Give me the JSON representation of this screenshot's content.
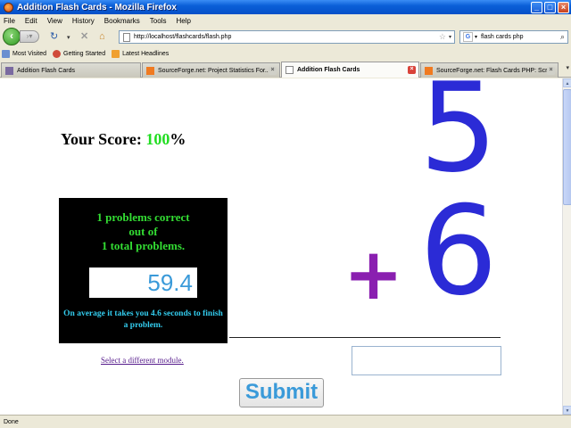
{
  "window": {
    "title": "Addition Flash Cards - Mozilla Firefox",
    "minimize_label": "_",
    "maximize_label": "□",
    "close_label": "×"
  },
  "menu": [
    "File",
    "Edit",
    "View",
    "History",
    "Bookmarks",
    "Tools",
    "Help"
  ],
  "nav": {
    "url": "http://localhost/flashcards/flash.php",
    "search_query": "flash cards php"
  },
  "bookmarks": [
    "Most Visited",
    "Getting Started",
    "Latest Headlines"
  ],
  "tabs": [
    {
      "label": "Addition Flash Cards",
      "active": false
    },
    {
      "label": "SourceForge.net: Project Statistics For...",
      "active": false
    },
    {
      "label": "Addition Flash Cards",
      "active": true
    },
    {
      "label": "SourceForge.net: Flash Cards PHP: Scr...",
      "active": false
    }
  ],
  "page": {
    "score_label": "Your Score: ",
    "score_value": "100",
    "score_suffix": "%",
    "stats_line1": "1 problems correct",
    "stats_line2": "out of",
    "stats_line3": "1 total problems.",
    "timer_value": "59.4",
    "average_text": "On average it takes you 4.6 seconds to finish a problem.",
    "module_link": "Select a different module.",
    "top_number": "5",
    "operator": "+",
    "bottom_number": "6",
    "answer_value": "",
    "submit_label": "Submit"
  },
  "status": "Done",
  "colors": {
    "number_color": "#2b2bd6",
    "operator_color": "#8a1fb0",
    "stats_green": "#33dd33",
    "score_green": "#22dd22",
    "timer_blue": "#3a9ad9"
  }
}
